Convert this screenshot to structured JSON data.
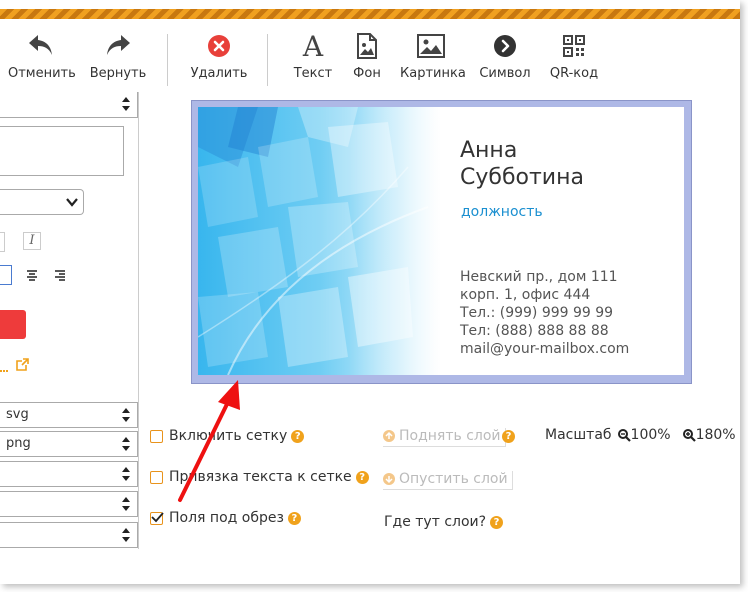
{
  "toolbar": {
    "undo_label": "Отменить",
    "redo_label": "Вернуть",
    "delete_label": "Удалить",
    "text_label": "Текст",
    "background_label": "Фон",
    "image_label": "Картинка",
    "symbol_label": "Символ",
    "qr_label": "QR-код",
    "text_icon_glyph": "A"
  },
  "left_panel": {
    "italic_label": "I",
    "formats": [
      "svg",
      "png"
    ]
  },
  "card": {
    "first_name": "Анна",
    "last_name": "Субботина",
    "position": "должность",
    "address_1": "Невский пр., дом 111",
    "address_2": "корп. 1, офис 444",
    "phone_1": "Тел.: (999) 999 99 99",
    "phone_2": "Тел: (888) 888 88 88",
    "email": "mail@your-mailbox.com"
  },
  "options": {
    "grid_label": "Включить сетку",
    "snap_label": "Привязка текста к сетке",
    "bleed_label": "Поля под обрез",
    "grid_checked": false,
    "snap_checked": false,
    "bleed_checked": true
  },
  "layers": {
    "raise_label": "Поднять слой",
    "lower_label": "Опустить слой",
    "where_label": "Где тут слои?"
  },
  "zoom": {
    "label": "Масштаб",
    "zoom_100": "100%",
    "zoom_180": "180%"
  },
  "colors": {
    "accent": "#f0a21c",
    "delete_red": "#e8403a",
    "card_position_blue": "#1a8fd0",
    "arrow_red": "#ee1111"
  }
}
